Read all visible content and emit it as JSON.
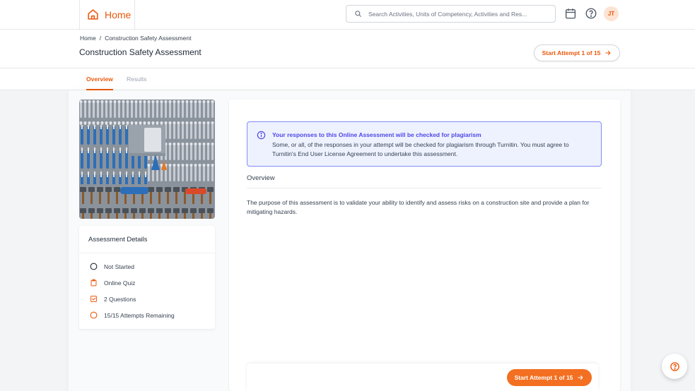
{
  "nav": {
    "home_label": "Home",
    "search_placeholder": "Search Activities, Units of Competency, Activities and Res...",
    "avatar_initials": "JT"
  },
  "header": {
    "breadcrumb_home": "Home",
    "breadcrumb_separator": "/",
    "breadcrumb_current": "Construction Safety Assessment",
    "title": "Construction Safety Assessment",
    "start_attempt_label": "Start Attempt 1 of 15"
  },
  "tabs": [
    {
      "label": "Overview",
      "active": true
    },
    {
      "label": "Results",
      "active": false
    }
  ],
  "details": {
    "title": "Assessment Details",
    "items": [
      {
        "icon": "circle-icon",
        "label": "Not Started"
      },
      {
        "icon": "clipboard-icon",
        "label": "Online Quiz"
      },
      {
        "icon": "checkbox-icon",
        "label": "2 Questions"
      },
      {
        "icon": "circle-icon",
        "label": "15/15 Attempts Remaining"
      }
    ]
  },
  "alert": {
    "title": "Your responses to this Online Assessment will be checked for plagiarism",
    "body": "Some, or all, of the responses in your attempt will be checked for plagiarism through Turnitin. You must agree to Turnitin's End User License Agreement to undertake this assessment."
  },
  "overview": {
    "heading": "Overview",
    "text": "The purpose of this assessment is to validate your ability to identify and assess risks on a construction site and provide a plan for mitigating hazards."
  },
  "footer": {
    "start_attempt_label": "Start Attempt 1 of 15"
  },
  "colors": {
    "accent": "#ea580c",
    "button_fill": "#f36f21",
    "alert_border": "#818cf8",
    "alert_bg": "#eef2ff"
  }
}
